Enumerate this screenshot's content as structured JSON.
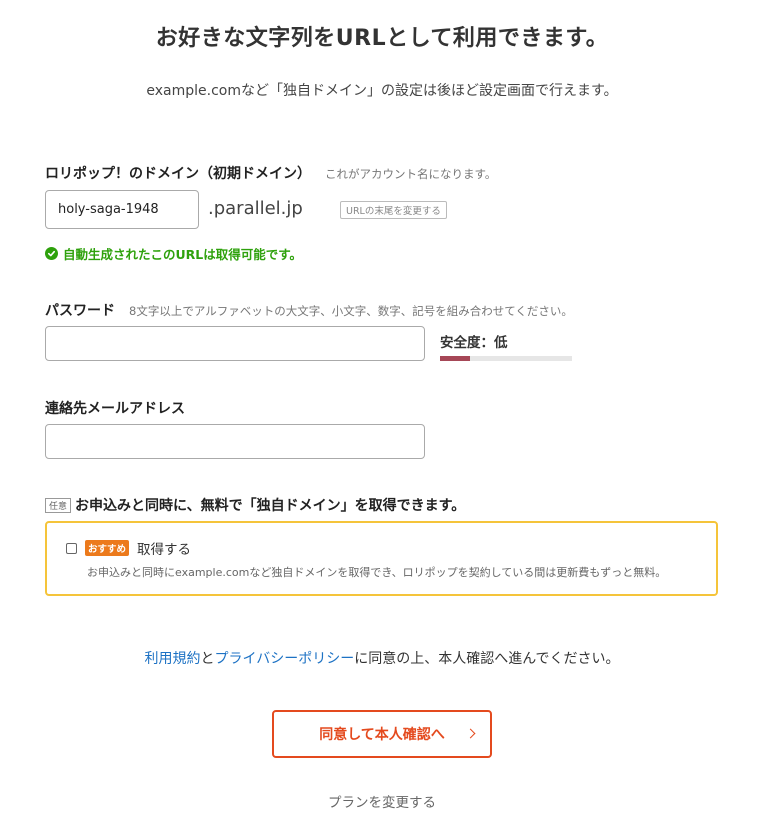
{
  "header": {
    "title": "お好きな文字列をURLとして利用できます。",
    "subtitle": "example.comなど「独自ドメイン」の設定は後ほど設定画面で行えます。"
  },
  "domain": {
    "label": "ロリポップ！のドメイン（初期ドメイン）",
    "hint": "これがアカウント名になります。",
    "value": "holy-saga-1948",
    "suffix": ".parallel.jp",
    "change_suffix_label": "URLの末尾を変更する",
    "availability": "自動生成されたこのURLは取得可能です。"
  },
  "password": {
    "label": "パスワード",
    "hint": "8文字以上でアルファベットの大文字、小文字、数字、記号を組み合わせてください。",
    "value": "",
    "strength_label": "安全度：低",
    "strength_fraction": 0.23
  },
  "email": {
    "label": "連絡先メールアドレス",
    "value": ""
  },
  "own_domain": {
    "optional_badge": "任意",
    "heading": "お申込みと同時に、無料で「独自ドメイン」を取得できます。",
    "recommend_badge": "おすすめ",
    "checkbox_label": "取得する",
    "checked": false,
    "description": "お申込みと同時にexample.comなど独自ドメインを取得でき、ロリポップを契約している間は更新費もずっと無料。"
  },
  "agreement": {
    "terms_link": "利用規約",
    "connector": "と",
    "privacy_link": "プライバシーポリシー",
    "rest": "に同意の上、本人確認へ進んでください。"
  },
  "actions": {
    "submit_label": "同意して本人確認へ",
    "change_plan_label": "プランを変更する"
  },
  "colors": {
    "success": "#2ea10c",
    "link": "#1d72c4",
    "cta": "#e44a1e",
    "strength_low": "#a64757",
    "promo_border": "#f5c43a",
    "recommend_badge": "#ec7a1c"
  }
}
